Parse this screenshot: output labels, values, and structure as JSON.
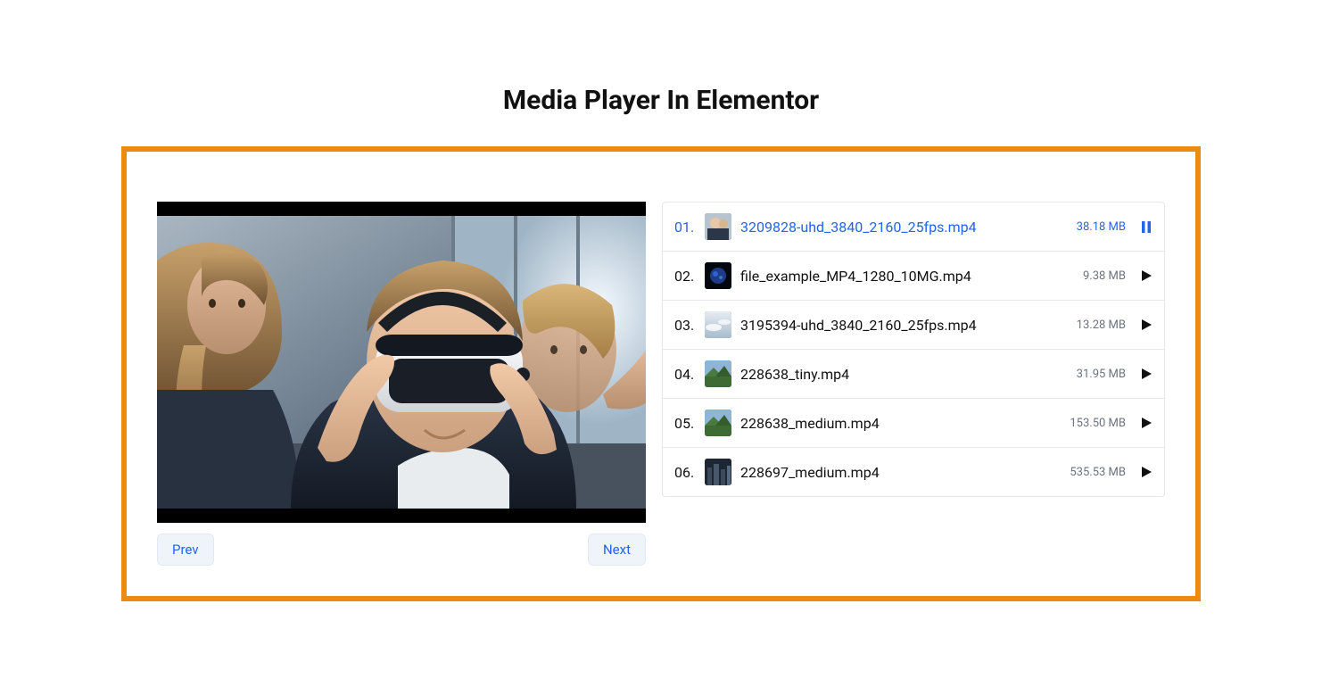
{
  "title": "Media Player In Elementor",
  "nav": {
    "prev": "Prev",
    "next": "Next"
  },
  "colors": {
    "accent": "#ed8b0d",
    "link": "#2563eb",
    "muted": "#6b7280",
    "border": "#e5e7eb",
    "btn_bg": "#eff3fa"
  },
  "playlist": [
    {
      "index": "01.",
      "name": "3209828-uhd_3840_2160_25fps.mp4",
      "size": "38.18 MB",
      "active": true,
      "state": "pause"
    },
    {
      "index": "02.",
      "name": "file_example_MP4_1280_10MG.mp4",
      "size": "9.38 MB",
      "active": false,
      "state": "play"
    },
    {
      "index": "03.",
      "name": "3195394-uhd_3840_2160_25fps.mp4",
      "size": "13.28 MB",
      "active": false,
      "state": "play"
    },
    {
      "index": "04.",
      "name": "228638_tiny.mp4",
      "size": "31.95 MB",
      "active": false,
      "state": "play"
    },
    {
      "index": "05.",
      "name": "228638_medium.mp4",
      "size": "153.50 MB",
      "active": false,
      "state": "play"
    },
    {
      "index": "06.",
      "name": "228697_medium.mp4",
      "size": "535.53 MB",
      "active": false,
      "state": "play"
    }
  ],
  "thumbnails": [
    "people",
    "planet",
    "sky",
    "landscape",
    "landscape",
    "urban"
  ]
}
